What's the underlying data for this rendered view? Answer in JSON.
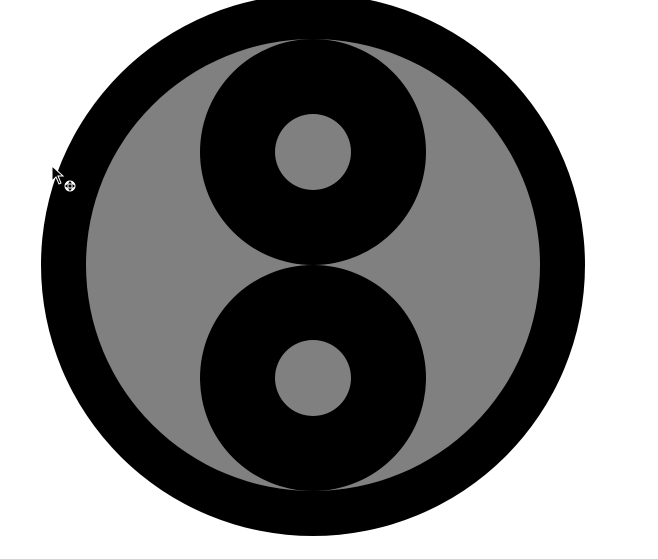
{
  "canvas": {
    "background": "#ffffff",
    "shapes": [
      {
        "name": "outer-ring",
        "fill": "#000000"
      },
      {
        "name": "inner-disc",
        "fill": "#808080"
      },
      {
        "name": "upper-ring",
        "fill": "#000000"
      },
      {
        "name": "upper-hole",
        "fill": "#808080"
      },
      {
        "name": "lower-ring",
        "fill": "#000000"
      },
      {
        "name": "lower-hole",
        "fill": "#808080"
      }
    ]
  },
  "cursor": {
    "icon": "move-cursor-icon",
    "pointer_fill": "#000000",
    "pointer_stroke": "#ffffff"
  }
}
